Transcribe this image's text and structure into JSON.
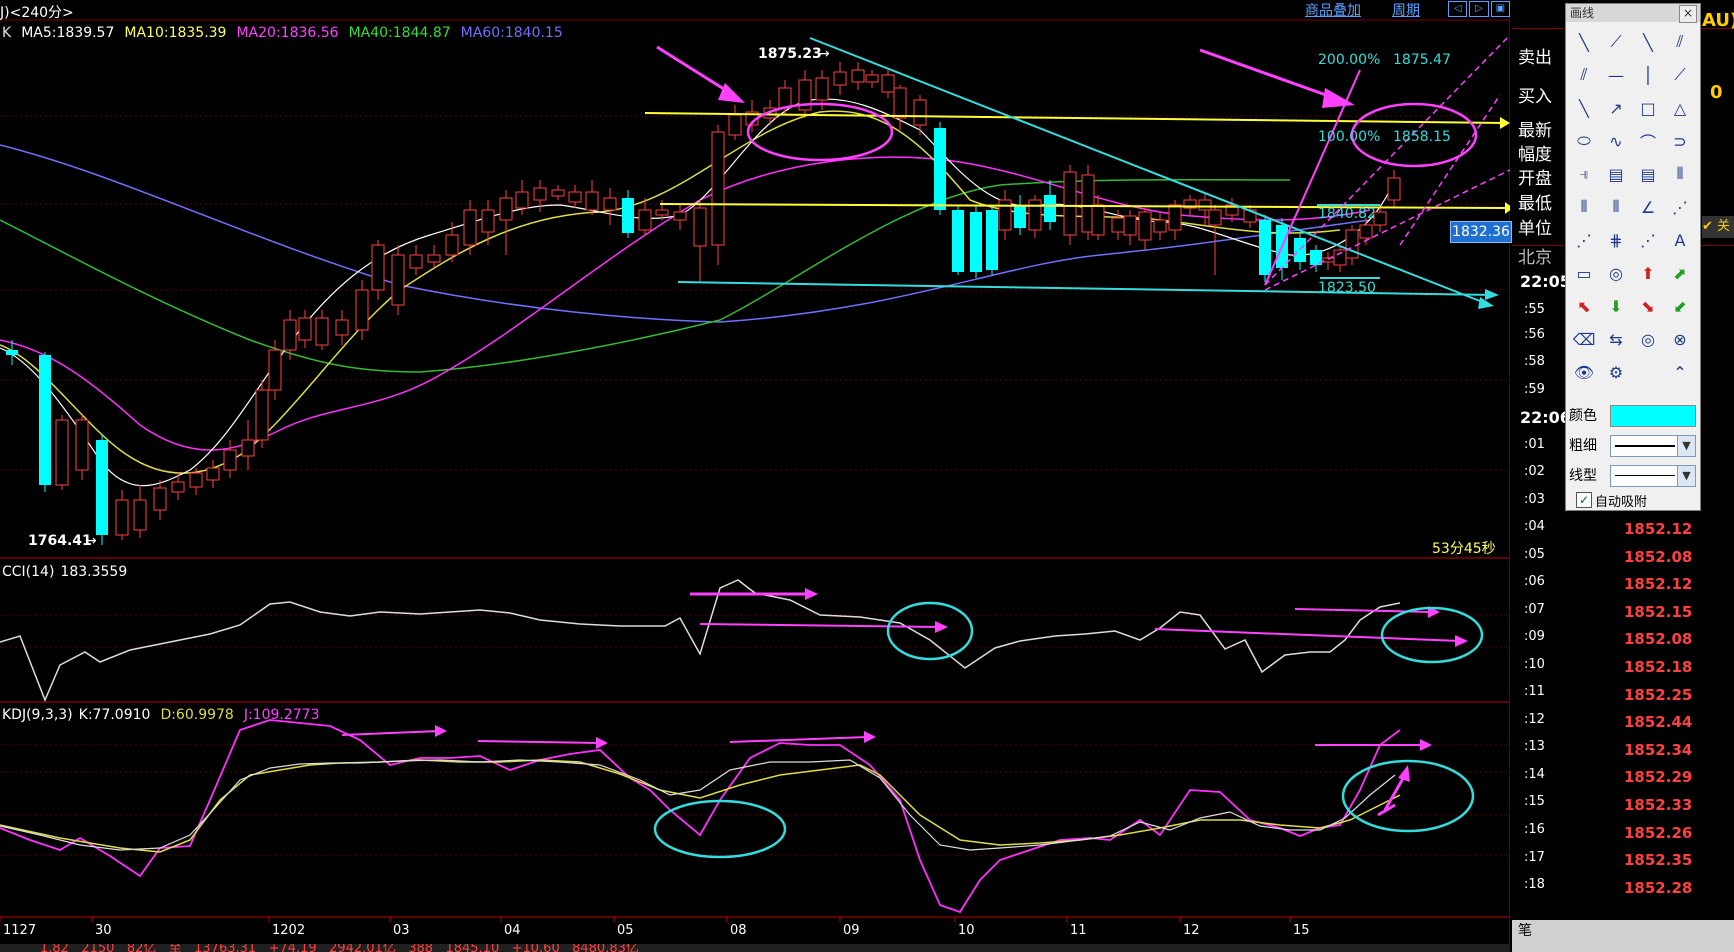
{
  "header": {
    "period": "J)<240分>",
    "buttons": [
      "商品叠加",
      "周期"
    ]
  },
  "ma_legend": [
    {
      "label": "K",
      "color": "#e0e0e0"
    },
    {
      "label": "MA5:1839.57",
      "color": "#ffffff"
    },
    {
      "label": "MA10:1835.39",
      "color": "#ffff66"
    },
    {
      "label": "MA20:1836.56",
      "color": "#ff40ff"
    },
    {
      "label": "MA40:1844.87",
      "color": "#33dd33"
    },
    {
      "label": "MA60:1840.15",
      "color": "#7070ff"
    }
  ],
  "price_annotations": {
    "high": "1875.23",
    "low": "1764.41",
    "low2": "1823.50",
    "fib_200": "200.00%",
    "fib_200_val": "1875.47",
    "fib_100": "100.00%",
    "fib_100_val": "1858.15",
    "fib_0_val": "1840.82",
    "countdown": "53分45秒",
    "current_price": "1832.36"
  },
  "cci_legend": {
    "name": "CCI(14)",
    "value": "183.3559"
  },
  "kdj_legend": {
    "name": "KDJ(9,3,3)",
    "k": "K:77.0910",
    "d": "D:60.9978",
    "j": "J:109.2773"
  },
  "x_axis": [
    "1127",
    "30",
    "1202",
    "03",
    "04",
    "05",
    "08",
    "09",
    "10",
    "11",
    "12",
    "15"
  ],
  "quote_labels": [
    "卖出",
    "买入",
    "最新",
    "幅度",
    "开盘",
    "最低",
    "单位",
    "北京"
  ],
  "quote_partial": [
    "AU)",
    "0",
    "✔ 关"
  ],
  "ticks": {
    "times_bold": [
      "22:05",
      "22:06"
    ],
    "times": [
      ":55",
      ":56",
      ":58",
      ":59",
      ":01",
      ":02",
      ":03",
      ":04",
      ":05",
      ":06",
      ":07",
      ":09",
      ":10",
      ":11",
      ":12",
      ":13",
      ":14",
      ":15",
      ":16",
      ":17",
      ":18"
    ],
    "values": [
      "1852.12",
      "1852.08",
      "1852.12",
      "1852.15",
      "1852.08",
      "1852.18",
      "1852.25",
      "1852.44",
      "1852.34",
      "1852.29",
      "1852.33",
      "1852.26",
      "1852.35",
      "1852.28"
    ]
  },
  "status_bar": {
    "label": "笔",
    "partial_text": "1.82   2150   82亿   至   13763.31   +74.19   2942.01亿   388   1845.10   +10.60   8480.83亿"
  },
  "toolbox": {
    "title": "画线",
    "color_label": "颜色",
    "width_label": "粗细",
    "style_label": "线型",
    "auto_snap": "自动吸附",
    "color_value": "#00ffff",
    "tools": [
      "diagonal-line-icon",
      "ray-line-icon",
      "segment-line-icon",
      "parallel-lines-icon",
      "parallel-channel-icon",
      "horizontal-line-icon",
      "vertical-line-icon",
      "arrow-line-icon",
      "line-down-icon",
      "arrow-up-right-icon",
      "rectangle-icon",
      "triangle-icon",
      "ellipse-icon",
      "sine-wave-icon",
      "arc-icon",
      "bracket-icon",
      "fib-retracement-icon",
      "fib-fan-icon",
      "fib-channel-icon",
      "period-lines-icon",
      "fib-time-icon",
      "gann-lines-icon",
      "angle-line-icon",
      "gann-fan-icon",
      "speed-lines-icon",
      "andrews-pitchfork-icon",
      "elliott-wave-icon",
      "text-icon",
      "ruler-icon",
      "target-icon",
      "arrow-up-icon",
      "arrow-up-right-red-icon",
      "arrow-down-left-icon",
      "arrow-down-icon",
      "arrow-down-right-icon",
      "arrow-down-left-green-icon",
      "eraser-icon",
      "delete-icon",
      "hide-icon",
      "lock-icon",
      "eye-icon",
      "gear-icon",
      "",
      "collapse-icon"
    ]
  }
}
